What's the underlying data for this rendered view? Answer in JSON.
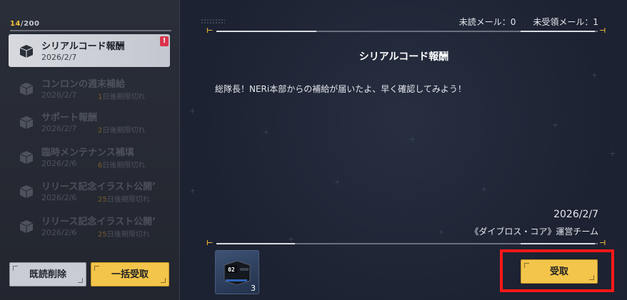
{
  "sidebar": {
    "counter_current": "14",
    "counter_total": "/200",
    "items": [
      {
        "title": "シリアルコード報酬",
        "date": "2026/2/7",
        "expire_num": "",
        "expire_text": "",
        "badge": "!"
      },
      {
        "title": "コンロンの週末補給",
        "date": "2026/2/7",
        "expire_num": "1",
        "expire_text": "日後期限切れ"
      },
      {
        "title": "サポート報酬",
        "date": "2026/2/7",
        "expire_num": "2",
        "expire_text": "日後期限切れ"
      },
      {
        "title": "臨時メンテナンス補填",
        "date": "2026/2/6",
        "expire_num": "6",
        "expire_text": "日後期限切れ"
      },
      {
        "title": "リリース記念イラスト公開’",
        "date": "2026/2/6",
        "expire_num": "25",
        "expire_text": "日後期限切れ"
      },
      {
        "title": "リリース記念イラスト公開’",
        "date": "2026/2/6",
        "expire_num": "25",
        "expire_text": "日後期限切れ"
      }
    ],
    "delete_read_label": "既読削除",
    "claim_all_label": "一括受取"
  },
  "main": {
    "unread_label": "未読メール：0",
    "unclaimed_label": "未受領メール：1",
    "title": "シリアルコード報酬",
    "body": "総隊長！NERi本部からの補給が届いたよ、早く確認してみよう！",
    "sign_date": "2026/2/7",
    "sign_team": "《ダイブロス・コア》運営チーム",
    "reward_label": "02",
    "reward_quantity": "3",
    "claim_label": "受取"
  },
  "colors": {
    "accent": "#f3c54a",
    "highlight": "#ff1818",
    "badge": "#d9344a"
  },
  "icons": [
    "box-icon",
    "alert-icon",
    "reward-item-icon"
  ]
}
